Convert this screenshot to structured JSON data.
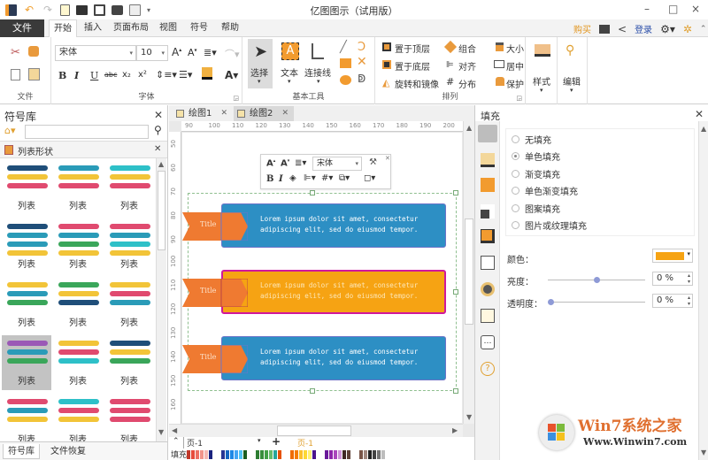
{
  "titlebar": {
    "title": "亿图图示（试用版）",
    "quick_access": [
      "app-logo",
      "undo",
      "redo",
      "new",
      "open",
      "save",
      "print",
      "export"
    ],
    "minimize": "–",
    "maximize": "□",
    "close": "×"
  },
  "menu": {
    "file": "文件",
    "tabs": [
      "开始",
      "插入",
      "页面布局",
      "视图",
      "符号",
      "帮助"
    ],
    "active_tab": "开始",
    "buy": "购买",
    "login": "登录"
  },
  "ribbon": {
    "file_group": {
      "label": "文件"
    },
    "font_group": {
      "label": "字体",
      "font_name": "宋体",
      "font_size": "10",
      "buttons": [
        "B",
        "I",
        "U",
        "abc",
        "x₂",
        "x²"
      ]
    },
    "tools_group": {
      "label": "基本工具",
      "select": "选择",
      "text": "文本",
      "connector": "连接线"
    },
    "arrange_group": {
      "label": "排列",
      "items": [
        "置于顶层",
        "置于底层",
        "旋转和镜像",
        "组合",
        "对齐",
        "分布",
        "大小",
        "居中",
        "保护"
      ]
    },
    "style": "样式",
    "edit": "编辑"
  },
  "library": {
    "title": "符号库",
    "category": "列表形状",
    "search_placeholder": "",
    "items": [
      {
        "label": "列表",
        "colors": [
          "#1f4e79",
          "#f2c438",
          "#e04a6f"
        ]
      },
      {
        "label": "列表",
        "colors": [
          "#2a9bb8",
          "#f2c438",
          "#e04a6f"
        ]
      },
      {
        "label": "列表",
        "colors": [
          "#2ec0c8",
          "#f2c438",
          "#e04a6f"
        ]
      },
      {
        "label": "列表",
        "colors": [
          "#1f4e79",
          "#2a9bb8",
          "#2a9bb8",
          "#f2c438"
        ]
      },
      {
        "label": "列表",
        "colors": [
          "#e04a6f",
          "#2a9bb8",
          "#3aa65a",
          "#f2c438"
        ]
      },
      {
        "label": "列表",
        "colors": [
          "#e04a6f",
          "#2a9bb8",
          "#2ec0c8",
          "#f2c438"
        ]
      },
      {
        "label": "列表",
        "colors": [
          "#f2c438",
          "#2a9bb8",
          "#3aa65a"
        ]
      },
      {
        "label": "列表",
        "colors": [
          "#3aa65a",
          "#f2c438",
          "#1f4e79"
        ]
      },
      {
        "label": "列表",
        "colors": [
          "#f2c438",
          "#e04a6f",
          "#2a9bb8"
        ]
      },
      {
        "label": "列表",
        "colors": [
          "#9b59b6",
          "#2a9bb8",
          "#3aa65a"
        ]
      },
      {
        "label": "列表",
        "colors": [
          "#f2c438",
          "#e04a6f",
          "#2ec0c8"
        ]
      },
      {
        "label": "列表",
        "colors": [
          "#1f4e79",
          "#f2c438",
          "#3aa65a"
        ]
      },
      {
        "label": "列表",
        "colors": [
          "#e04a6f",
          "#2a9bb8",
          "#f2c438"
        ]
      },
      {
        "label": "列表",
        "colors": [
          "#2ec0c8",
          "#e04a6f",
          "#f2c438"
        ]
      },
      {
        "label": "列表",
        "colors": [
          "#e04a6f",
          "#e04a6f",
          "#e04a6f"
        ]
      }
    ],
    "selected_index": 9,
    "bottom_tabs": [
      "符号库",
      "文件恢复"
    ]
  },
  "documents": {
    "tabs": [
      "绘图1",
      "绘图2"
    ],
    "active": "绘图2"
  },
  "canvas": {
    "hruler": [
      "90",
      "100",
      "110",
      "120",
      "130",
      "140",
      "150",
      "160",
      "170",
      "180",
      "190",
      "200"
    ],
    "vruler": [
      "50",
      "60",
      "70",
      "80",
      "90",
      "100",
      "110",
      "120",
      "130",
      "140",
      "150",
      "160"
    ],
    "mini_toolbar": {
      "font": "宋体"
    },
    "list_items": [
      {
        "title": "Title",
        "text": "Lorem ipsum dolor sit amet, consectetur adipiscing elit, sed do eiusmod tempor.",
        "color": "#2d8fc4",
        "selected": false
      },
      {
        "title": "Title",
        "text": "Lorem ipsum dolor sit amet, consectetur adipiscing elit, sed do eiusmod tempor.",
        "color": "#f6a313",
        "selected": true
      },
      {
        "title": "Title",
        "text": "Lorem ipsum dolor sit amet, consectetur adipiscing elit, sed do eiusmod tempor.",
        "color": "#2d8fc4",
        "selected": false
      }
    ],
    "ribbon_color": "#ef7a31"
  },
  "pages": {
    "current": "页-1",
    "active_page_tab": "页-1",
    "fill_label": "填充"
  },
  "fill_panel": {
    "title": "填充",
    "options": [
      "无填充",
      "单色填充",
      "渐变填充",
      "单色渐变填充",
      "图案填充",
      "图片或纹理填充"
    ],
    "selected": "单色填充",
    "color_label": "颜色：",
    "color_value": "#f6a313",
    "brightness_label": "亮度：",
    "brightness_value": "0 %",
    "brightness_level": 0.5,
    "transparency_label": "透明度：",
    "transparency_value": "0 %",
    "transparency_level": 0.0
  },
  "watermark": {
    "brand": "Win7系统之家",
    "url": "Www.Winwin7.com"
  },
  "palette": [
    "#c0392b",
    "#e74c3c",
    "#ec7063",
    "#f1948a",
    "#f5b7b1",
    "#1a237e",
    "#283593",
    "#1565c0",
    "#1e88e5",
    "#42a5f5",
    "#4fc3f7",
    "#1b5e20",
    "#2e7d32",
    "#388e3c",
    "#43a047",
    "#66bb6a",
    "#26a69a",
    "#e65100",
    "#ef6c00",
    "#f57c00",
    "#fbc02d",
    "#fdd835",
    "#fff176",
    "#4a148c",
    "#6a1b9a",
    "#8e24aa",
    "#ab47bc",
    "#ce93d8",
    "#3e2723",
    "#5d4037",
    "#795548",
    "#a1887f",
    "#212121",
    "#424242",
    "#757575",
    "#bdbdbd"
  ]
}
